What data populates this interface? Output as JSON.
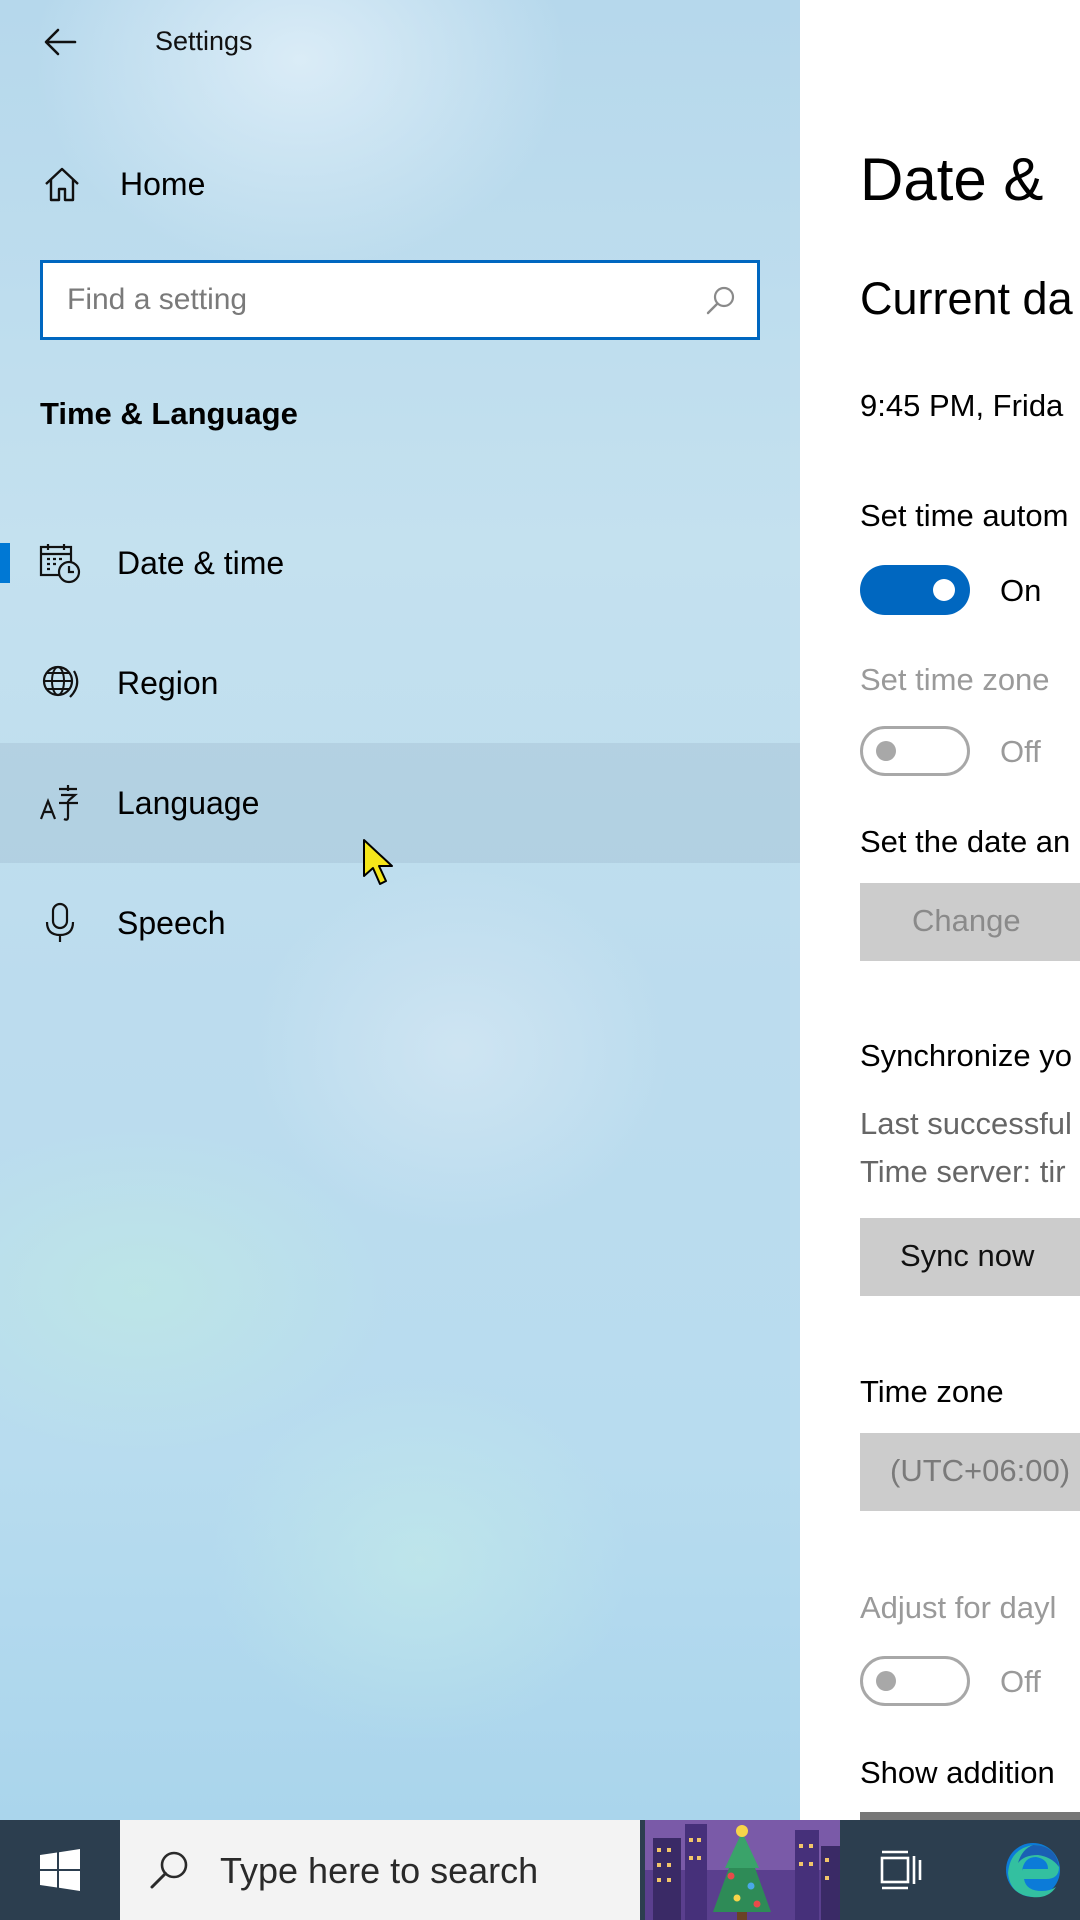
{
  "window": {
    "title": "Settings"
  },
  "nav": {
    "home_label": "Home",
    "search_placeholder": "Find a setting",
    "section_title": "Time & Language",
    "items": [
      {
        "label": "Date & time",
        "icon": "calendar-clock-icon",
        "selected": true
      },
      {
        "label": "Region",
        "icon": "globe-icon"
      },
      {
        "label": "Language",
        "icon": "language-icon",
        "hovered": true
      },
      {
        "label": "Speech",
        "icon": "microphone-icon"
      }
    ]
  },
  "content": {
    "page_title": "Date &",
    "current_section": "Current da",
    "current_time": "9:45 PM, Frida",
    "set_time_auto": {
      "label": "Set time autom",
      "state": "On",
      "on": true
    },
    "set_timezone_auto": {
      "label": "Set time zone",
      "state": "Off",
      "on": false,
      "disabled": true
    },
    "manual_date": {
      "label": "Set the date an",
      "button": "Change"
    },
    "sync": {
      "heading": "Synchronize yo",
      "last_sync": "Last successful",
      "time_server": "Time server: tir",
      "button": "Sync now"
    },
    "time_zone": {
      "label": "Time zone",
      "value": "(UTC+06:00)"
    },
    "dst": {
      "label": "Adjust for dayl",
      "state": "Off",
      "on": false,
      "disabled": true
    },
    "additional": {
      "label": "Show addition"
    }
  },
  "taskbar": {
    "search_placeholder": "Type here to search",
    "icons": [
      "windows-start-icon",
      "search-icon",
      "search-highlight-image",
      "task-view-icon",
      "edge-icon"
    ]
  },
  "colors": {
    "accent": "#0067c0",
    "selection_bar": "#0078d4",
    "taskbar": "#2c3e4f"
  }
}
